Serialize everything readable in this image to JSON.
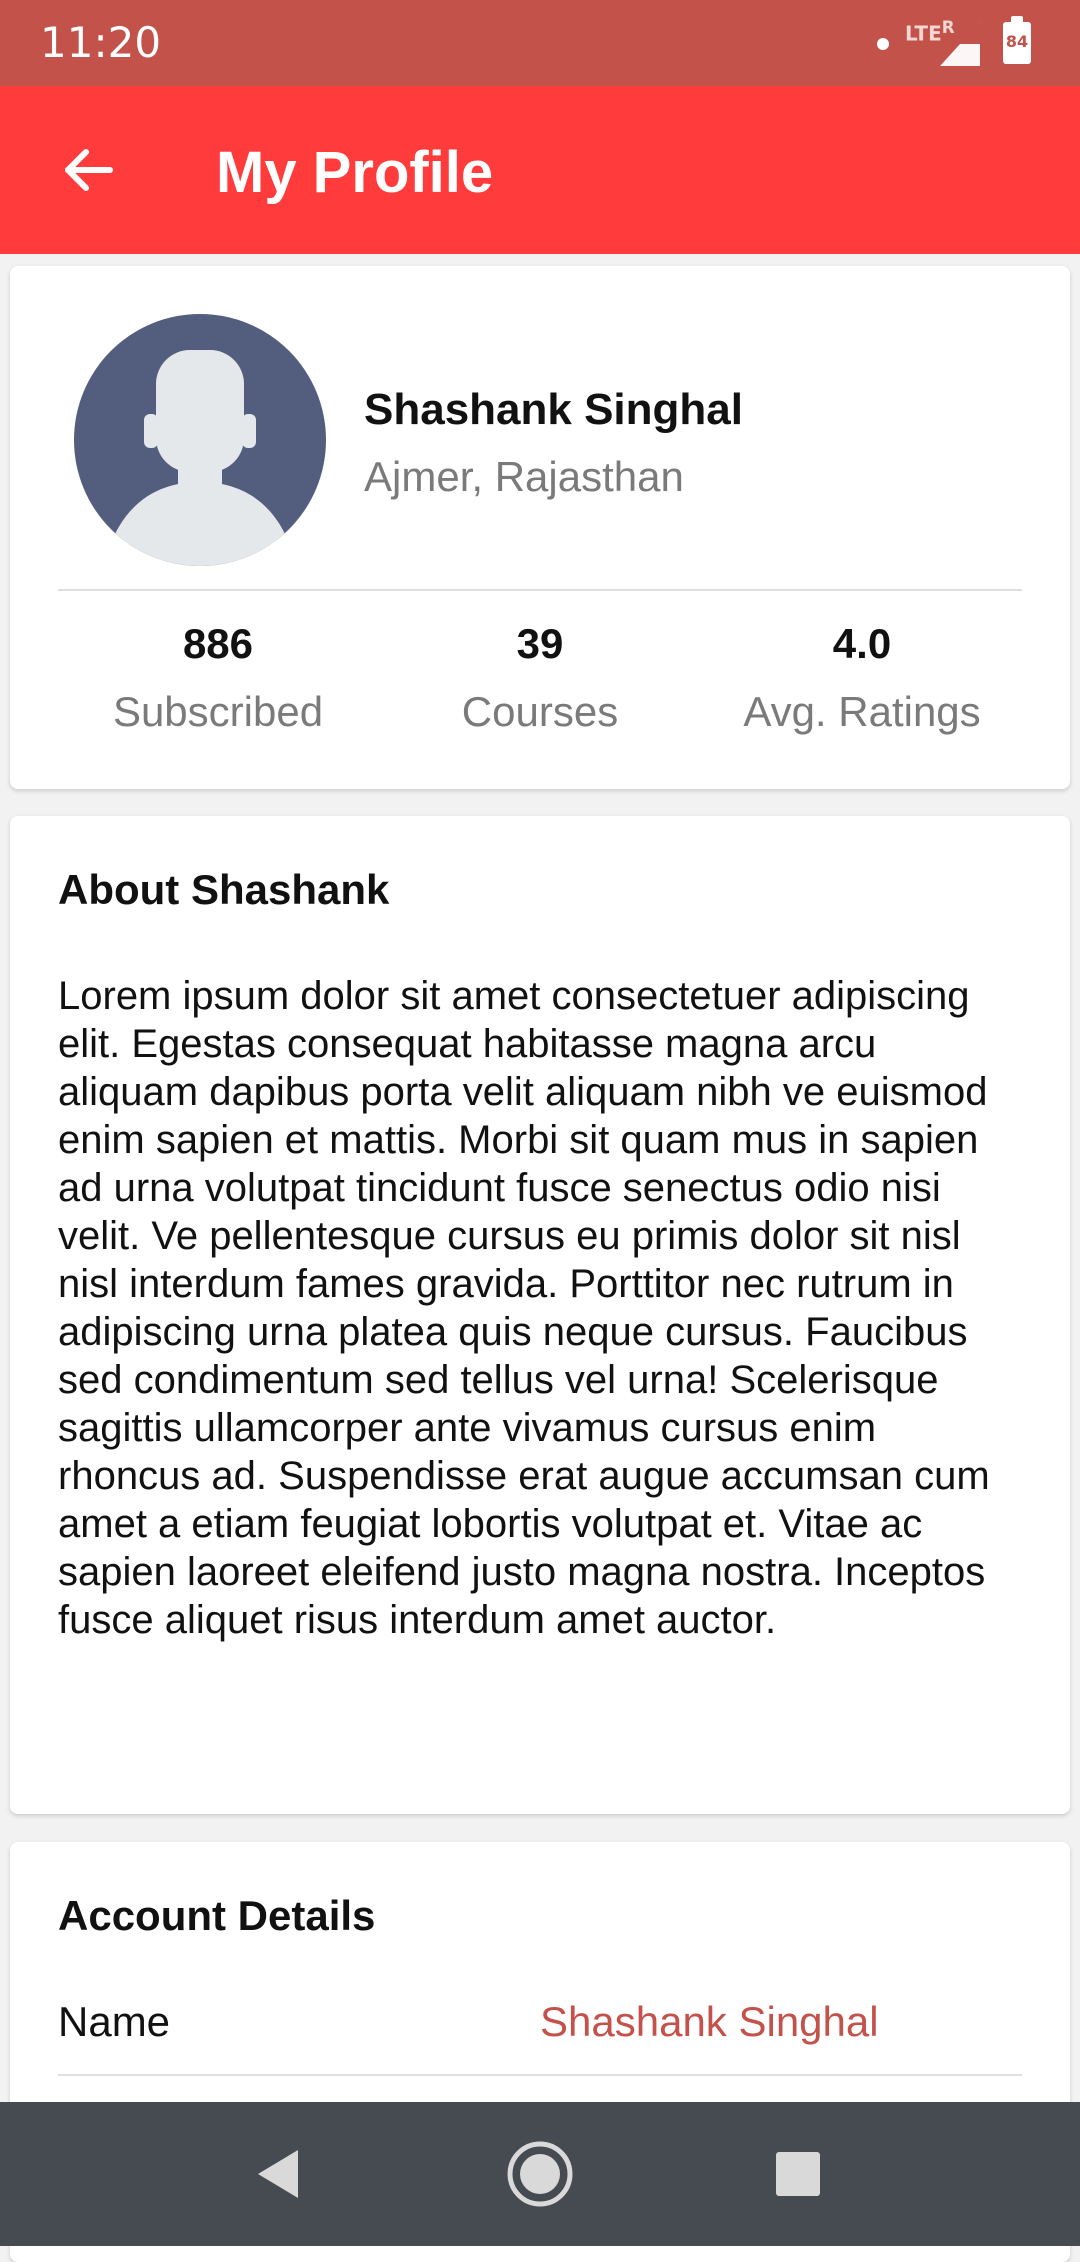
{
  "status_bar": {
    "time": "11:20",
    "network": "LTE",
    "roaming": "R",
    "battery": "84"
  },
  "app_bar": {
    "title": "My Profile",
    "back_icon": "arrow-left-icon"
  },
  "profile": {
    "name": "Shashank Singhal",
    "location": "Ajmer, Rajasthan",
    "avatar_icon": "person-silhouette-icon",
    "stats": [
      {
        "value": "886",
        "label": "Subscribed"
      },
      {
        "value": "39",
        "label": "Courses"
      },
      {
        "value": "4.0",
        "label": "Avg. Ratings"
      }
    ]
  },
  "about": {
    "title": "About Shashank",
    "text": "Lorem ipsum dolor sit amet consectetuer adipiscing elit. Egestas consequat habitasse magna arcu aliquam dapibus porta velit aliquam nibh ve euismod enim sapien et mattis. Morbi sit quam mus in sapien ad urna volutpat tincidunt fusce senectus odio nisi velit. Ve pellentesque cursus eu primis dolor sit nisl nisl interdum fames gravida. Porttitor nec rutrum in adipiscing urna platea quis neque cursus. Faucibus sed condimentum sed tellus vel urna! Scelerisque sagittis ullamcorper ante vivamus cursus enim rhoncus ad. Suspendisse erat augue accumsan cum amet a etiam feugiat lobortis volutpat et. Vitae ac sapien laoreet eleifend justo magna nostra. Inceptos fusce aliquet risus interdum amet auctor."
  },
  "account": {
    "title": "Account Details",
    "rows": [
      {
        "label": "Name",
        "value": "Shashank Singhal"
      }
    ]
  },
  "nav_bar": {
    "back_icon": "triangle-back-icon",
    "home_icon": "circle-home-icon",
    "recents_icon": "square-recents-icon"
  },
  "colors": {
    "status_bar": "#c2524a",
    "app_bar": "#ff3b3b",
    "avatar_bg": "#535e7e",
    "accent_text": "#c2524a",
    "nav_bar": "#464b51"
  }
}
